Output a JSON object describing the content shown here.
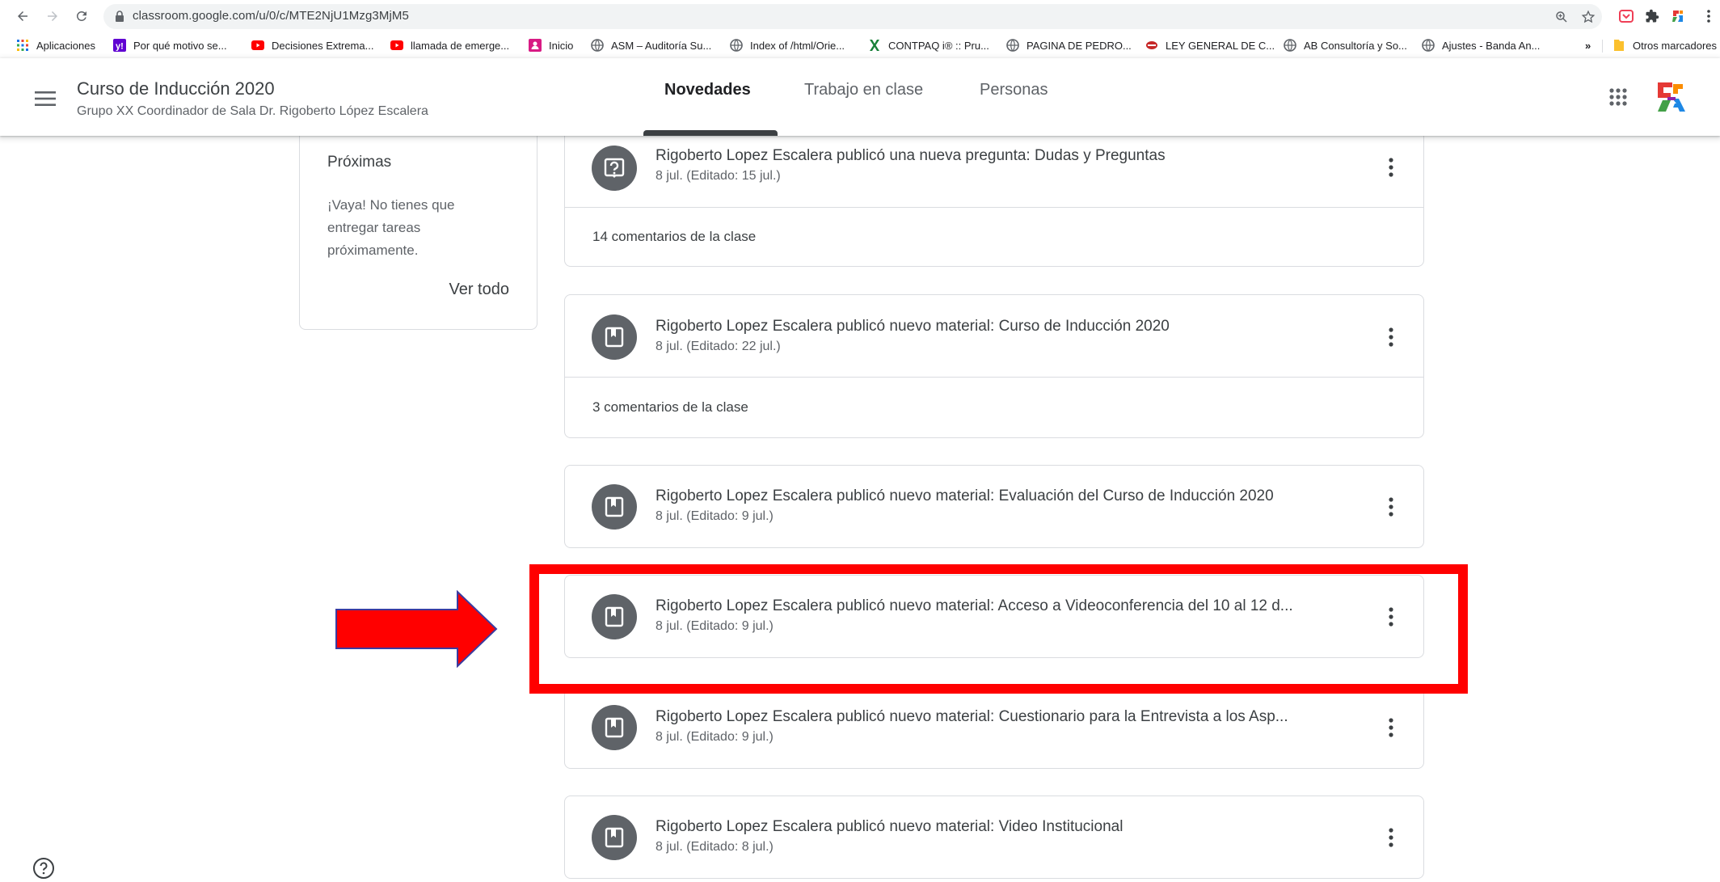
{
  "browser": {
    "url": "classroom.google.com/u/0/c/MTE2NjU1Mzg3MjM5",
    "bookmarks": [
      {
        "label": "Aplicaciones",
        "icon": "apps-grid-icon",
        "color": "#1a73e8"
      },
      {
        "label": "Por qué motivo se...",
        "icon": "yahoo-icon",
        "color": "#6001d2"
      },
      {
        "label": "Decisiones Extrema...",
        "icon": "youtube-icon",
        "color": "#ff0000"
      },
      {
        "label": "llamada de emerge...",
        "icon": "youtube-icon",
        "color": "#ff0000"
      },
      {
        "label": "Inicio",
        "icon": "profile-card-icon",
        "color": "#d81b84"
      },
      {
        "label": "ASM – Auditoría Su...",
        "icon": "globe-icon",
        "color": "#5f6368"
      },
      {
        "label": "Index of /html/Orie...",
        "icon": "globe-icon",
        "color": "#5f6368"
      },
      {
        "label": "CONTPAQ i® :: Pru...",
        "icon": "excel-x-icon",
        "color": "#188038"
      },
      {
        "label": "PAGINA DE PEDRO...",
        "icon": "globe-icon",
        "color": "#5f6368"
      },
      {
        "label": "LEY GENERAL DE C...",
        "icon": "seal-icon",
        "color": "#c62828"
      },
      {
        "label": "AB Consultoría y So...",
        "icon": "globe-icon",
        "color": "#5f6368"
      },
      {
        "label": "Ajustes - Banda An...",
        "icon": "globe-icon",
        "color": "#5f6368"
      }
    ],
    "overflow_label": "»",
    "other_bookmarks": "Otros marcadores"
  },
  "header": {
    "course_title": "Curso de Inducción 2020",
    "course_subtitle": "Grupo XX Coordinador de Sala Dr. Rigoberto López Escalera",
    "tabs": [
      {
        "label": "Novedades",
        "active": true
      },
      {
        "label": "Trabajo en clase",
        "active": false
      },
      {
        "label": "Personas",
        "active": false
      }
    ]
  },
  "upcoming": {
    "title": "Próximas",
    "empty_text": "¡Vaya! No tienes que entregar tareas próximamente.",
    "view_all": "Ver todo"
  },
  "posts": [
    {
      "type": "question",
      "icon": "question-icon",
      "title": "Rigoberto Lopez Escalera publicó una nueva pregunta: Dudas y Preguntas",
      "date": "8 jul. (Editado: 15 jul.)",
      "comments": "14 comentarios de la clase"
    },
    {
      "type": "material",
      "icon": "material-book-icon",
      "title": "Rigoberto Lopez Escalera publicó nuevo material: Curso de Inducción 2020",
      "date": "8 jul. (Editado: 22 jul.)",
      "comments": "3 comentarios de la clase"
    },
    {
      "type": "material",
      "icon": "material-book-icon",
      "title": "Rigoberto Lopez Escalera publicó nuevo material: Evaluación del Curso de Inducción 2020",
      "date": "8 jul. (Editado: 9 jul.)",
      "comments": ""
    },
    {
      "type": "material",
      "icon": "material-book-icon",
      "title": "Rigoberto Lopez Escalera publicó nuevo material: Acceso a Videoconferencia del 10 al 12 d...",
      "date": "8 jul. (Editado: 9 jul.)",
      "comments": ""
    },
    {
      "type": "material",
      "icon": "material-book-icon",
      "title": "Rigoberto Lopez Escalera publicó nuevo material: Cuestionario para la Entrevista a los Asp...",
      "date": "8 jul. (Editado: 9 jul.)",
      "comments": ""
    },
    {
      "type": "material",
      "icon": "material-book-icon",
      "title": "Rigoberto Lopez Escalera publicó nuevo material: Video Institucional",
      "date": "8 jul. (Editado: 8 jul.)",
      "comments": ""
    }
  ],
  "colors": {
    "annotation_red": "#ff0000",
    "icon_grey": "#5f6368",
    "border": "#dadce0"
  }
}
